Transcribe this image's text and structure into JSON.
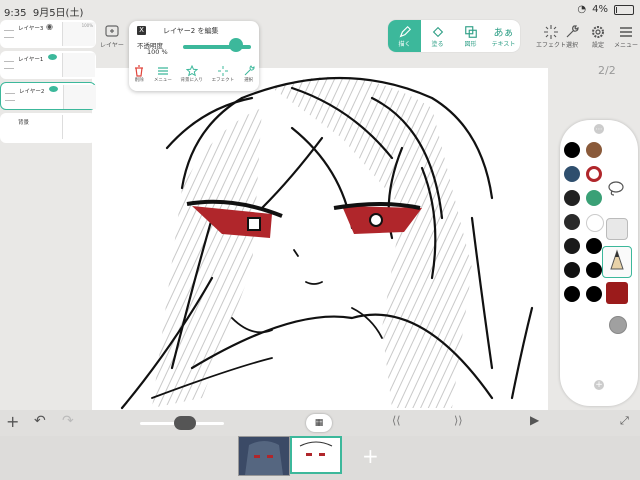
{
  "status": {
    "time": "9:35",
    "date": "9月5日(土)",
    "battery": "4%"
  },
  "toolbar": {
    "layer_label": "レイヤー",
    "tools": [
      {
        "label": "描く",
        "icon": "pencil-icon",
        "active": true
      },
      {
        "label": "塗る",
        "icon": "bucket-icon",
        "active": false
      },
      {
        "label": "図形",
        "icon": "shapes-icon",
        "active": false
      },
      {
        "label": "テキスト",
        "icon": "text-icon",
        "active": false,
        "glyph": "あぁ"
      }
    ],
    "right": [
      {
        "label": "エフェクト",
        "icon": "sparkle-icon"
      },
      {
        "label": "選択",
        "icon": "wrench-icon"
      },
      {
        "label": "設定",
        "icon": "gear-icon"
      },
      {
        "label": "メニュー",
        "icon": "menu-icon"
      }
    ]
  },
  "layers": [
    {
      "name": "レイヤー3",
      "badge": "100%"
    },
    {
      "name": "レイヤー1",
      "badge": ""
    },
    {
      "name": "レイヤー2",
      "badge": ""
    },
    {
      "name": "背景",
      "badge": ""
    }
  ],
  "popup": {
    "title": "レイヤー2 を編集",
    "close": "X",
    "opacity_label": "不透明度",
    "opacity_value": "100 %",
    "opacity_fraction": 1.0,
    "actions": [
      {
        "label": "削除",
        "icon": "trash-icon",
        "color": "#e0453c"
      },
      {
        "label": "メニュー",
        "icon": "menu-icon",
        "color": "#3cb89b"
      },
      {
        "label": "背景に入り",
        "icon": "star-icon",
        "color": "#3cb89b"
      },
      {
        "label": "エフェクト",
        "icon": "sparkle-icon",
        "color": "#3cb89b"
      },
      {
        "label": "選択",
        "icon": "wrench-icon",
        "color": "#3cb89b"
      }
    ]
  },
  "page_indicator": "2/2",
  "palette": {
    "colors": [
      "#000000",
      "#8a5a3a",
      "#2f4f6e",
      "#b0262b",
      "#222222",
      "#3aa076",
      "#2a2a2a",
      "#ffffff",
      "#1a1a1a",
      "#000000",
      "#111111",
      "#000000",
      "#000000",
      "#000000"
    ],
    "selected_color": "#b0262b",
    "tool_colors": {
      "brush": "#9b1b1b",
      "extra": "#a0a0a0"
    }
  },
  "accent": "#3cb89b",
  "brush_size": 0.4
}
